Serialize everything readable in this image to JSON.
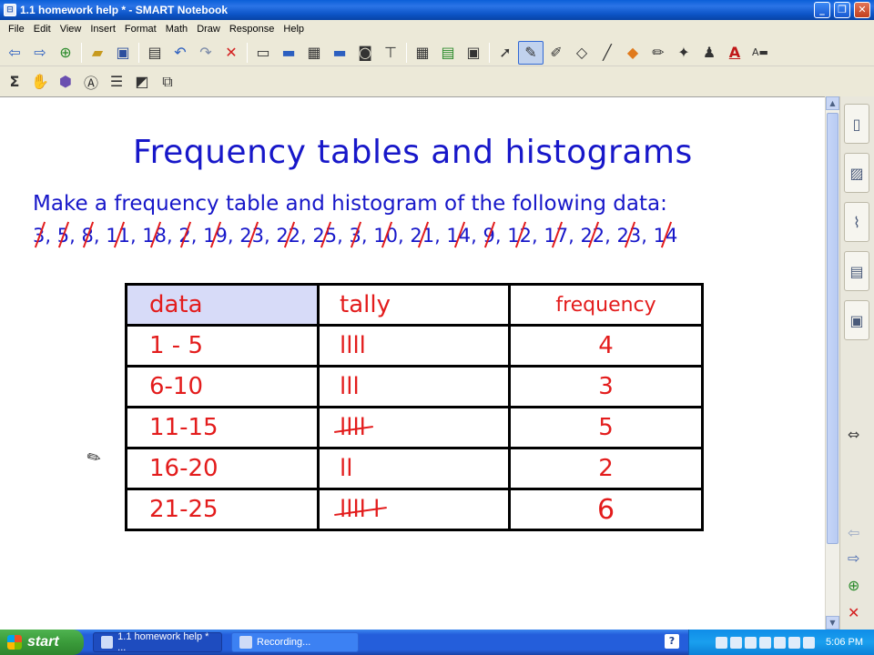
{
  "window": {
    "title": "1.1 homework help * - SMART Notebook",
    "minimize_glyph": "_",
    "maximize_glyph": "❐",
    "close_glyph": "✕"
  },
  "menu": [
    "File",
    "Edit",
    "View",
    "Insert",
    "Format",
    "Math",
    "Draw",
    "Response",
    "Help"
  ],
  "toolbar1_icons": [
    "back-arrow-icon",
    "forward-arrow-icon",
    "add-page-icon",
    "open-folder-icon",
    "save-icon",
    "paste-icon",
    "undo-icon",
    "redo-icon",
    "delete-icon",
    "screen-shade-icon",
    "display-icon",
    "show-hide-icon",
    "monitor-icon",
    "capture-icon",
    "table-tool-icon",
    "table-icon",
    "insert-icon",
    "record-icon",
    "select-icon",
    "pen-icon",
    "creative-pen-icon",
    "eraser-icon",
    "line-icon",
    "shapes-icon",
    "magic-pen-icon",
    "fill-icon",
    "text-icon",
    "properties-icon"
  ],
  "toolbar2_icons": [
    "sigma-icon",
    "hand-icon",
    "3d-icon",
    "text-recognize-icon",
    "table-select-icon",
    "chart-icon",
    "group-icon"
  ],
  "page": {
    "heading": "Frequency tables and histograms",
    "instruction": "Make a frequency table and histogram of the following data:",
    "data_values": [
      "3",
      "5",
      "8",
      "11",
      "18",
      "2",
      "19",
      "23",
      "22",
      "25",
      "3",
      "10",
      "21",
      "14",
      "9",
      "12",
      "17",
      "22",
      "23",
      "14"
    ]
  },
  "table": {
    "headers": [
      "data",
      "tally",
      "frequency"
    ],
    "rows": [
      {
        "range": "1 - 5",
        "tally": "llll",
        "frequency": "4"
      },
      {
        "range": "6-10",
        "tally": "lll",
        "frequency": "3"
      },
      {
        "range": "11-15",
        "tally": "llll",
        "frequency": "5"
      },
      {
        "range": "16-20",
        "tally": "ll",
        "frequency": "2"
      },
      {
        "range": "21-25",
        "tally": "llll l",
        "frequency": "6"
      }
    ]
  },
  "sidepanel": {
    "tabs": [
      "page-sorter-icon",
      "gallery-icon",
      "attachments-icon",
      "properties-icon",
      "addons-icon"
    ],
    "move_glyph": "⇔"
  },
  "taskbar": {
    "start_label": "start",
    "tasks": [
      "1.1 homework help * ...",
      "Recording..."
    ],
    "help_glyph": "?",
    "clock": "5:06 PM"
  }
}
